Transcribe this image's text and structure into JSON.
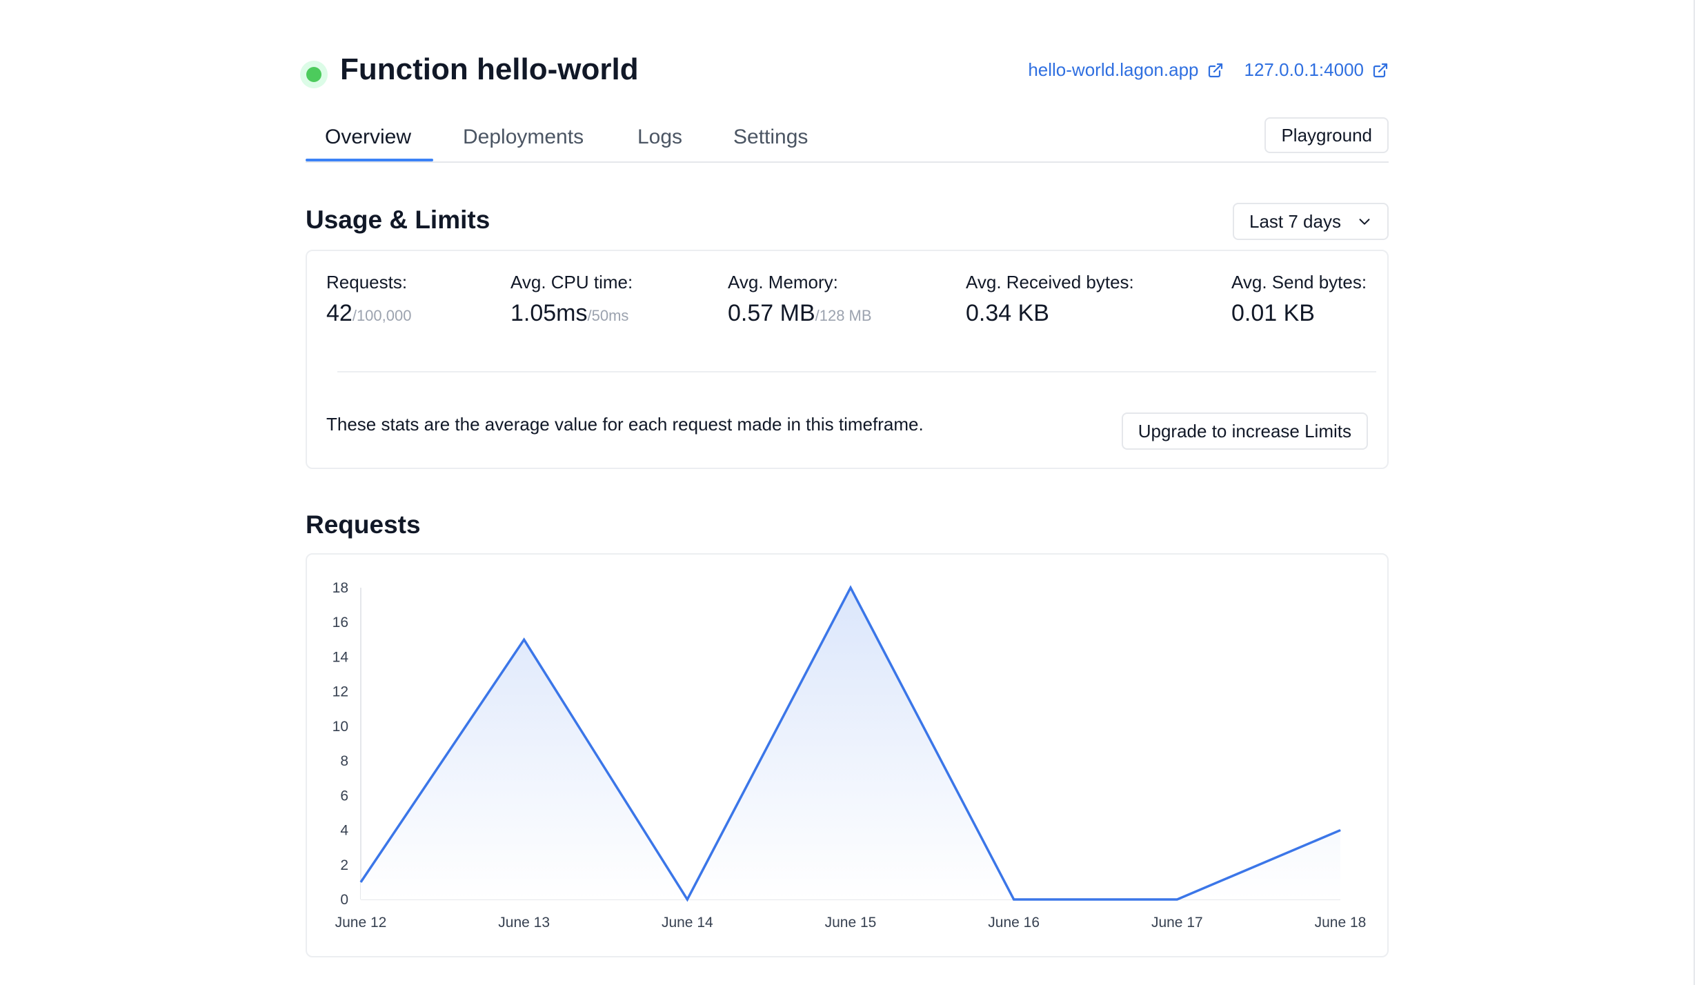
{
  "header": {
    "title": "Function hello-world",
    "status_color": "#4ccb5c",
    "links": [
      {
        "label": "hello-world.lagon.app",
        "icon": "external-link-icon"
      },
      {
        "label": "127.0.0.1:4000",
        "icon": "external-link-icon"
      }
    ]
  },
  "tabs": {
    "items": [
      {
        "label": "Overview",
        "active": true
      },
      {
        "label": "Deployments",
        "active": false
      },
      {
        "label": "Logs",
        "active": false
      },
      {
        "label": "Settings",
        "active": false
      }
    ],
    "playground_label": "Playground"
  },
  "usage": {
    "title": "Usage & Limits",
    "timeframe": {
      "selected": "Last 7 days",
      "icon": "chevron-down-icon"
    },
    "stats": [
      {
        "label": "Requests:",
        "value": "42",
        "limit": "/100,000"
      },
      {
        "label": "Avg. CPU time:",
        "value": "1.05ms",
        "limit": "/50ms"
      },
      {
        "label": "Avg. Memory:",
        "value": "0.57 MB",
        "limit": "/128 MB"
      },
      {
        "label": "Avg. Received bytes:",
        "value": "0.34 KB",
        "limit": ""
      },
      {
        "label": "Avg. Send bytes:",
        "value": "0.01 KB",
        "limit": ""
      }
    ],
    "note": "These stats are the average value for each request made in this timeframe.",
    "upgrade_label": "Upgrade to increase Limits"
  },
  "requests": {
    "title": "Requests"
  },
  "chart_data": {
    "type": "area",
    "title": "",
    "xlabel": "",
    "ylabel": "",
    "categories": [
      "June 12",
      "June 13",
      "June 14",
      "June 15",
      "June 16",
      "June 17",
      "June 18"
    ],
    "series": [
      {
        "values": [
          1,
          15,
          0,
          18,
          0,
          0,
          4
        ]
      }
    ],
    "ylim": [
      0,
      18
    ],
    "yticks": [
      0,
      2,
      4,
      6,
      8,
      10,
      12,
      14,
      16,
      18
    ],
    "grid": false,
    "legend": "none",
    "line_color": "#3b76e8",
    "fill_color": "#dbe6fb"
  }
}
